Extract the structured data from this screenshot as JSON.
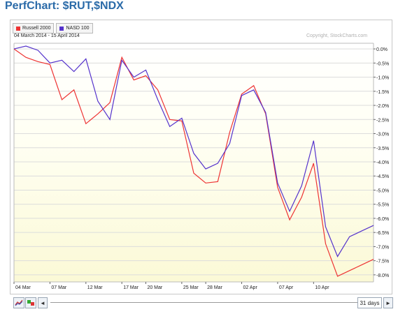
{
  "page": {
    "title": "PerfChart: $RUT,$NDX"
  },
  "legend": [
    {
      "label": "Russell 2000",
      "color": "#ee3333"
    },
    {
      "label": "NASD 100",
      "color": "#5533cc"
    }
  ],
  "date_range": "04 March 2014 - 15 April 2014",
  "copyright": "Copyright, StockCharts.com",
  "toolbar": {
    "days_label": "31 days",
    "left_arrow": "◄",
    "right_arrow": "►"
  },
  "chart_data": {
    "type": "line",
    "x": [
      "04 Mar",
      "05 Mar",
      "06 Mar",
      "07 Mar",
      "10 Mar",
      "11 Mar",
      "12 Mar",
      "13 Mar",
      "14 Mar",
      "17 Mar",
      "18 Mar",
      "19 Mar",
      "20 Mar",
      "21 Mar",
      "24 Mar",
      "25 Mar",
      "26 Mar",
      "27 Mar",
      "28 Mar",
      "31 Mar",
      "01 Apr",
      "02 Apr",
      "03 Apr",
      "04 Apr",
      "07 Apr",
      "08 Apr",
      "09 Apr",
      "10 Apr",
      "11 Apr",
      "14 Apr",
      "15 Apr"
    ],
    "x_tick_labels": [
      "04 Mar",
      "07 Mar",
      "12 Mar",
      "17 Mar",
      "20 Mar",
      "25 Mar",
      "28 Mar",
      "02 Apr",
      "07 Apr",
      "10 Apr"
    ],
    "x_tick_index": [
      0,
      3,
      6,
      9,
      11,
      14,
      16,
      19,
      22,
      25
    ],
    "series": [
      {
        "name": "Russell 2000",
        "color": "#ee3333",
        "values": [
          0.0,
          -0.3,
          -0.45,
          -0.55,
          -1.8,
          -1.45,
          -2.65,
          -2.3,
          -1.9,
          -0.3,
          -1.1,
          -0.95,
          -1.45,
          -2.5,
          -2.55,
          -4.4,
          -4.75,
          -4.7,
          -2.95,
          -1.6,
          -1.3,
          -2.3,
          -4.9,
          -6.05,
          -5.25,
          -4.05,
          -6.9,
          -8.05,
          -7.85,
          -7.65,
          -7.45
        ]
      },
      {
        "name": "NASD 100",
        "color": "#5533cc",
        "values": [
          0.0,
          0.1,
          -0.05,
          -0.5,
          -0.4,
          -0.8,
          -0.35,
          -1.85,
          -2.5,
          -0.4,
          -1.0,
          -0.75,
          -1.8,
          -2.75,
          -2.45,
          -3.7,
          -4.25,
          -4.05,
          -3.35,
          -1.65,
          -1.45,
          -2.25,
          -4.75,
          -5.75,
          -4.85,
          -3.25,
          -6.3,
          -7.35,
          -6.65,
          -6.45,
          -6.25
        ]
      }
    ],
    "y_ticks": [
      "0.0%",
      "-0.5%",
      "-1.0%",
      "-1.5%",
      "-2.0%",
      "-2.5%",
      "-3.0%",
      "-3.5%",
      "-4.0%",
      "-4.5%",
      "-5.0%",
      "-5.5%",
      "-6.0%",
      "-6.5%",
      "-7.0%",
      "-7.5%",
      "-8.0%"
    ],
    "ylim": [
      -8.25,
      0.2
    ],
    "grid": true,
    "legend_position": "top-left"
  }
}
